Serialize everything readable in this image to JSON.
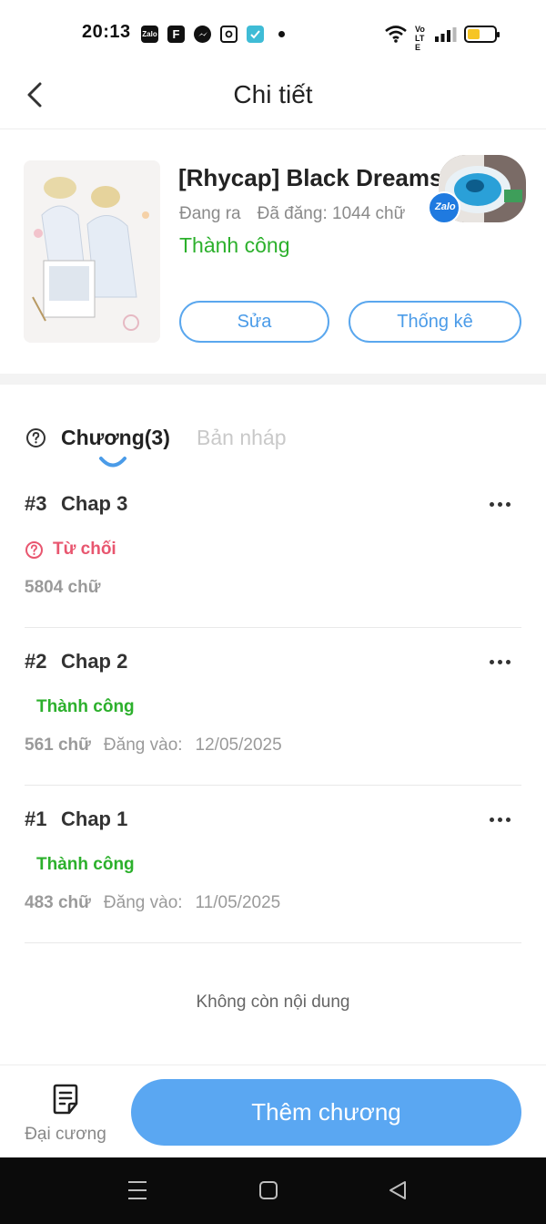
{
  "status_bar": {
    "time": "20:13",
    "apps": [
      "Zalo",
      "F",
      "messenger-icon",
      "instagram-icon",
      "check-app-icon"
    ],
    "zalo_label": "Zalo",
    "fb_label": "F",
    "volte_label": "Vo LTE",
    "battery_level": 0.45,
    "battery_color": "#f6c524"
  },
  "header": {
    "title": "Chi tiết"
  },
  "book": {
    "title": "[Rhycap] Black Dreams",
    "state": "Đang ra",
    "published_words": "Đã đăng: 1044 chữ",
    "status": "Thành công",
    "edit_label": "Sửa",
    "stats_label": "Thống kê",
    "overlay_label": "Zalo"
  },
  "tabs": {
    "chapters": "Chương(3)",
    "drafts": "Bản nháp"
  },
  "chapters": [
    {
      "num": "#3",
      "title": "Chap 3",
      "status": "Từ chối",
      "words": "5804 chữ",
      "published_label": "",
      "date": ""
    },
    {
      "num": "#2",
      "title": "Chap 2",
      "status": "Thành công",
      "words": "561 chữ",
      "published_label": "Đăng vào:",
      "date": "12/05/2025"
    },
    {
      "num": "#1",
      "title": "Chap 1",
      "status": "Thành công",
      "words": "483 chữ",
      "published_label": "Đăng vào:",
      "date": "11/05/2025"
    }
  ],
  "empty_text": "Không còn nội dung",
  "bottom": {
    "outline_label": "Đại cương",
    "add_chapter_label": "Thêm chương"
  },
  "colors": {
    "accent": "#5aa7f2",
    "success": "#2cb02c",
    "rejected": "#e8566f"
  }
}
